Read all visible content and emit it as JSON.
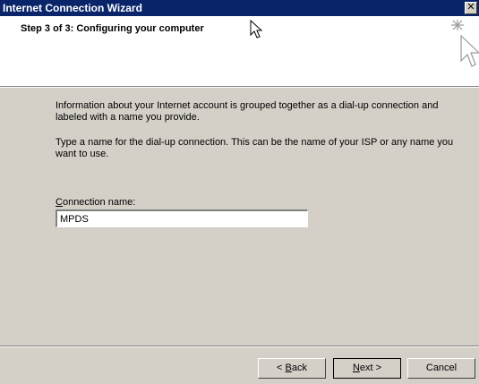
{
  "window": {
    "title": "Internet Connection Wizard",
    "close_glyph": "✕"
  },
  "header": {
    "step_title": "Step 3 of 3: Configuring your computer",
    "icon": "wizard-sparkle-icon"
  },
  "content": {
    "paragraph_1": "Information about your Internet account is grouped together as a dial-up connection and labeled with a name you provide.",
    "paragraph_2": "Type a name for the dial-up connection. This can be the name of your ISP or any name you want to use.",
    "connection_label_accel": "C",
    "connection_label_rest": "onnection name:",
    "connection_name_value": "MPDS"
  },
  "footer": {
    "back_prefix": "< ",
    "back_accel": "B",
    "back_rest": "ack",
    "next_accel": "N",
    "next_rest": "ext >",
    "cancel_label": "Cancel"
  }
}
